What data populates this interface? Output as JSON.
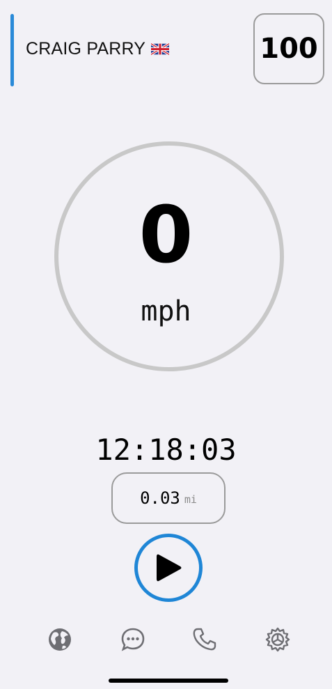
{
  "header": {
    "rider_name": "CRAIG PARRY",
    "flag_icon": "uk-flag-icon",
    "rider_number": "100",
    "accent_color": "#2a8ad8"
  },
  "speed": {
    "value": "0",
    "unit": "mph"
  },
  "clock": {
    "time": "12:18:03"
  },
  "distance": {
    "value": "0.03",
    "unit": "mi"
  },
  "play_button": {
    "icon": "play-icon",
    "ring_color": "#1f86d6"
  },
  "bottom_nav": {
    "items": [
      {
        "icon": "globe-icon"
      },
      {
        "icon": "chat-icon"
      },
      {
        "icon": "phone-icon"
      },
      {
        "icon": "settings-icon"
      }
    ],
    "icon_color": "#6e6e73"
  }
}
